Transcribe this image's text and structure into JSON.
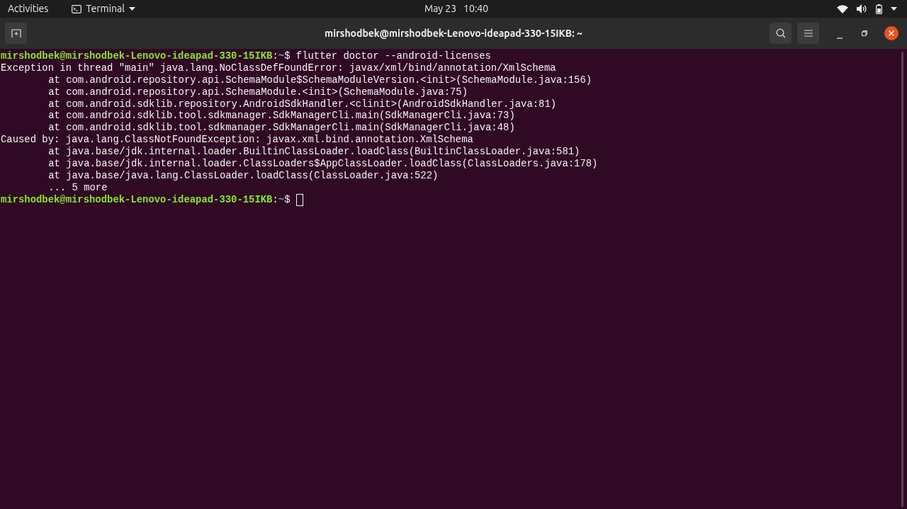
{
  "top_bar": {
    "activities": "Activities",
    "app_menu": "Terminal",
    "date": "May 23",
    "time": "10:40"
  },
  "window": {
    "title": "mirshodbek@mirshodbek-Lenovo-ideapad-330-15IKB: ~"
  },
  "terminal": {
    "lines": [
      {
        "kind": "prompt",
        "user_host": "mirshodbek@mirshodbek-Lenovo-ideapad-330-15IKB",
        "separator": ":",
        "path": "~",
        "symbol": "$",
        "command": "flutter doctor --android-licenses"
      },
      {
        "kind": "output",
        "text": "Exception in thread \"main\" java.lang.NoClassDefFoundError: javax/xml/bind/annotation/XmlSchema"
      },
      {
        "kind": "trace",
        "text": "at com.android.repository.api.SchemaModule$SchemaModuleVersion.<init>(SchemaModule.java:156)"
      },
      {
        "kind": "trace",
        "text": "at com.android.repository.api.SchemaModule.<init>(SchemaModule.java:75)"
      },
      {
        "kind": "trace",
        "text": "at com.android.sdklib.repository.AndroidSdkHandler.<clinit>(AndroidSdkHandler.java:81)"
      },
      {
        "kind": "trace",
        "text": "at com.android.sdklib.tool.sdkmanager.SdkManagerCli.main(SdkManagerCli.java:73)"
      },
      {
        "kind": "trace",
        "text": "at com.android.sdklib.tool.sdkmanager.SdkManagerCli.main(SdkManagerCli.java:48)"
      },
      {
        "kind": "output",
        "text": "Caused by: java.lang.ClassNotFoundException: javax.xml.bind.annotation.XmlSchema"
      },
      {
        "kind": "trace",
        "text": "at java.base/jdk.internal.loader.BuiltinClassLoader.loadClass(BuiltinClassLoader.java:581)"
      },
      {
        "kind": "trace",
        "text": "at java.base/jdk.internal.loader.ClassLoaders$AppClassLoader.loadClass(ClassLoaders.java:178)"
      },
      {
        "kind": "trace",
        "text": "at java.base/java.lang.ClassLoader.loadClass(ClassLoader.java:522)"
      },
      {
        "kind": "trace",
        "text": "... 5 more"
      },
      {
        "kind": "prompt",
        "user_host": "mirshodbek@mirshodbek-Lenovo-ideapad-330-15IKB",
        "separator": ":",
        "path": "~",
        "symbol": "$",
        "cursor": true
      }
    ]
  }
}
